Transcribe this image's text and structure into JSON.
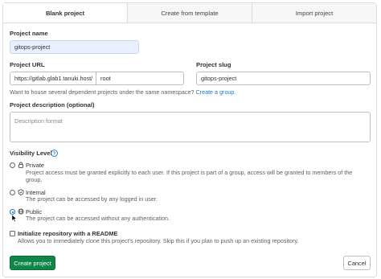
{
  "tabs": [
    {
      "label": "Blank project",
      "active": true
    },
    {
      "label": "Create from template",
      "active": false
    },
    {
      "label": "Import project",
      "active": false
    }
  ],
  "project_name": {
    "label": "Project name",
    "value": "gitops-project"
  },
  "project_url": {
    "label": "Project URL",
    "prefix": "https://gitlab.glab1.tanuki.host/",
    "namespace": "root"
  },
  "project_slug": {
    "label": "Project slug",
    "value": "gitops-project"
  },
  "namespace_help": {
    "text": "Want to house several dependent projects under the same namespace?",
    "link": "Create a group."
  },
  "description": {
    "label": "Project description (optional)",
    "placeholder": "Description format"
  },
  "visibility": {
    "label": "Visibility Level",
    "options": [
      {
        "title": "Private",
        "desc_line1": "Project access must be granted explicitly to each user. If this project is part of a group, access will be granted to members of the",
        "desc_line2": "group.",
        "checked": false,
        "icon": "lock-icon"
      },
      {
        "title": "Internal",
        "desc_line1": "The project can be accessed by any logged in user.",
        "checked": false,
        "icon": "shield-icon"
      },
      {
        "title": "Public",
        "desc_line1": "The project can be accessed without any authentication.",
        "checked": true,
        "icon": "earth-icon"
      }
    ]
  },
  "readme": {
    "label": "Initialize repository with a README",
    "desc": "Allows you to immediately clone this project’s repository. Skip this if you plan to push up an existing repository.",
    "checked": false
  },
  "buttons": {
    "create": "Create project",
    "cancel": "Cancel"
  },
  "colors": {
    "primary": "#108548",
    "link": "#1f75cb",
    "input_tint": "#e8f0fe"
  }
}
